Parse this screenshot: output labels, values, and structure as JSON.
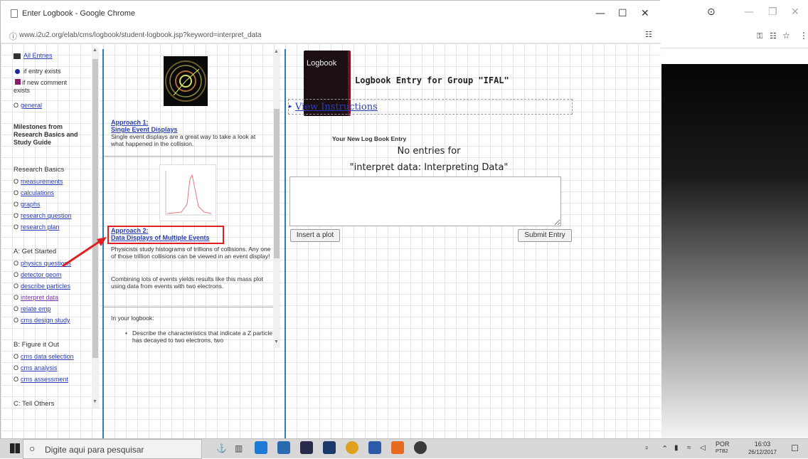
{
  "browser": {
    "window_title": "Enter Logbook - Google Chrome",
    "url": "www.i2u2.org/elab/cms/logbook/student-logbook.jsp?keyword=interpret_data"
  },
  "leftnav": {
    "all_entries": "All Entries",
    "legend_exists": "if entry exists",
    "legend_comment": "if new comment exists",
    "general": "general",
    "milestones_heading": "Milestones from Research Basics and Study Guide",
    "research_basics": "Research Basics",
    "research_items": [
      "measurements",
      "calculations",
      "graphs",
      "research question",
      "research plan"
    ],
    "section_a": "A: Get Started",
    "a_items": [
      "physics questions",
      "detector geom",
      "describe particles",
      "interpret data",
      "relate emp",
      "cms design study"
    ],
    "section_b": "B: Figure it Out",
    "b_items": [
      "cms data selection",
      "cms analysis",
      "cms assessment"
    ],
    "section_c": "C: Tell Others"
  },
  "midpanel": {
    "approach1_title": "Approach 1:",
    "approach1_link": "Single Event Displays",
    "approach1_text": "Single event displays are a great way to take a look at what happened in the collision.",
    "approach2_title": "Approach 2:",
    "approach2_link": "Data Displays of Multiple Events",
    "approach2_text": "Physicists study histograms of trillions of collisions. Any one of those trillion collisions can be viewed in an event display!",
    "approach2_text2": "Combining lots of events yields results like this mass plot using data from events with two electrons.",
    "logbook_intro": "In your logbook:",
    "bullet1": "Describe the characteristics that indicate a Z particle has decayed to two electrons, two"
  },
  "main": {
    "logbook_icon_label": "Logbook",
    "heading": "Logbook Entry for Group \"IFAL\"",
    "view_instructions": "View Instructions",
    "new_entry_label": "Your New Log Book Entry",
    "no_entries_line1": "No entries for",
    "no_entries_line2": "\"interpret data: Interpreting Data\"",
    "textarea_value": "",
    "insert_plot": "Insert a plot",
    "submit_entry": "Submit Entry"
  },
  "taskbar": {
    "search_placeholder": "Digite aqui para pesquisar",
    "lang": "POR",
    "lang_sub": "PTB2",
    "time": "16:03",
    "date": "26/12/2017"
  },
  "colors": {
    "link": "#2a3fb0",
    "highlight": "#e02020",
    "visited": "#7a3aa8"
  }
}
